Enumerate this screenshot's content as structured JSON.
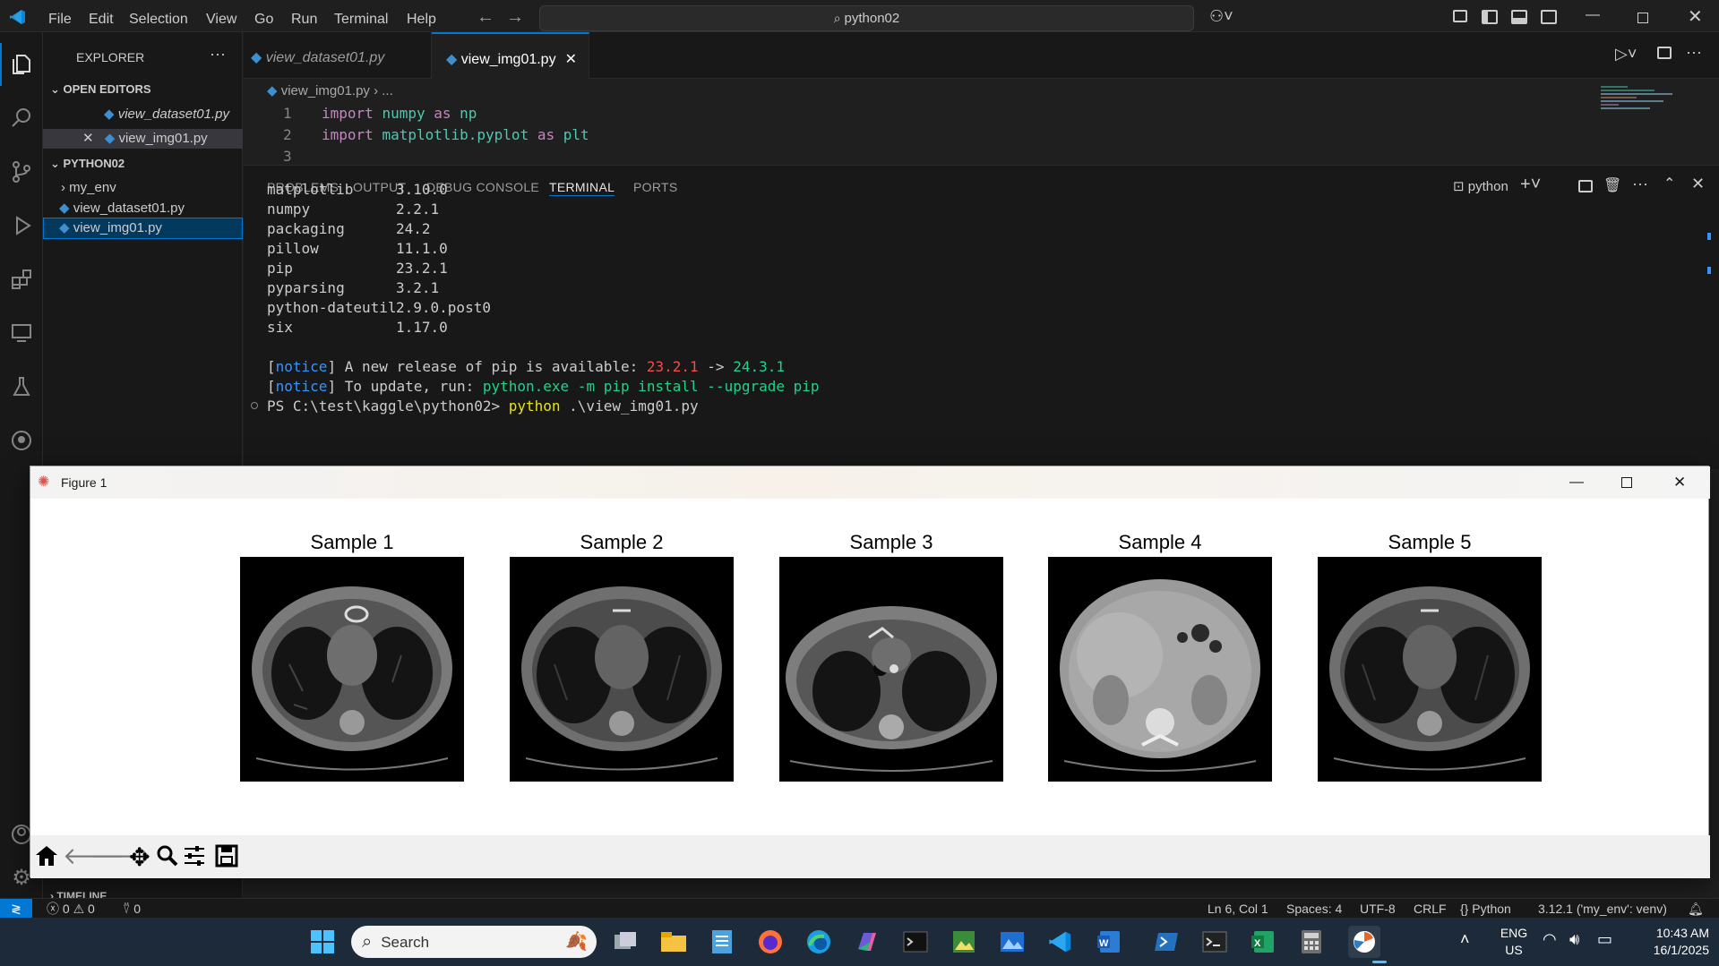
{
  "titlebar": {
    "menu": [
      "File",
      "Edit",
      "Selection",
      "View",
      "Go",
      "Run",
      "Terminal",
      "Help"
    ],
    "search_text": "python02"
  },
  "sidebar": {
    "header": "EXPLORER",
    "open_editors_label": "OPEN EDITORS",
    "open_editors": [
      "view_dataset01.py",
      "view_img01.py"
    ],
    "folder_label": "PYTHON02",
    "items": [
      "my_env",
      "view_dataset01.py",
      "view_img01.py"
    ],
    "timeline_label": "TIMELINE"
  },
  "tabs": [
    "view_dataset01.py",
    "view_img01.py"
  ],
  "breadcrumb": {
    "file": "view_img01.py",
    "rest": "..."
  },
  "code": {
    "line_numbers": [
      "1",
      "2",
      "3"
    ],
    "line1": {
      "kw": "import",
      "mod": "numpy",
      "as": "as",
      "alias": "np"
    },
    "line2": {
      "kw": "import",
      "mod": "matplotlib.pyplot",
      "as": "as",
      "alias": "plt"
    }
  },
  "panel": {
    "tabs": [
      "PROBLEMS",
      "OUTPUT",
      "DEBUG CONSOLE",
      "TERMINAL",
      "PORTS"
    ],
    "shell_label": "python"
  },
  "terminal": {
    "packages": [
      [
        "matplotlib",
        "3.10.0"
      ],
      [
        "numpy",
        "2.2.1"
      ],
      [
        "packaging",
        "24.2"
      ],
      [
        "pillow",
        "11.1.0"
      ],
      [
        "pip",
        "23.2.1"
      ],
      [
        "pyparsing",
        "3.2.1"
      ],
      [
        "python-dateutil",
        "2.9.0.post0"
      ],
      [
        "six",
        "1.17.0"
      ]
    ],
    "notice1": {
      "bracket_open": "[",
      "tag": "notice",
      "bracket_close": "]",
      "text": " A new release of pip is available: ",
      "old": "23.2.1",
      "arrow": " -> ",
      "new": "24.3.1"
    },
    "notice2": {
      "bracket_open": "[",
      "tag": "notice",
      "bracket_close": "]",
      "text": " To update, run: ",
      "cmd": "python.exe -m pip install --upgrade pip"
    },
    "prompt": "PS C:\\test\\kaggle\\python02>",
    "command": "python",
    "args": " .\\view_img01.py"
  },
  "figure": {
    "title": "Figure 1",
    "samples": [
      "Sample 1",
      "Sample 2",
      "Sample 3",
      "Sample 4",
      "Sample 5"
    ]
  },
  "status": {
    "errors": "0",
    "warnings": "0",
    "ports": "0",
    "position": "Ln 6, Col 1",
    "spaces": "Spaces: 4",
    "encoding": "UTF-8",
    "eol": "CRLF",
    "language": "Python",
    "interpreter": "3.12.1 ('my_env': venv)"
  },
  "taskbar": {
    "search_placeholder": "Search",
    "lang1": "ENG",
    "lang2": "US",
    "time": "10:43 AM",
    "date": "16/1/2025"
  },
  "colors": {
    "accent": "#0078d4",
    "keyword": "#c586c0",
    "module": "#4ec9b0",
    "notice": "#3794ff",
    "old_version": "#f14c4c",
    "new_version": "#23d18b",
    "cmd": "#23d18b",
    "prompt_cmd": "#e5e510"
  }
}
